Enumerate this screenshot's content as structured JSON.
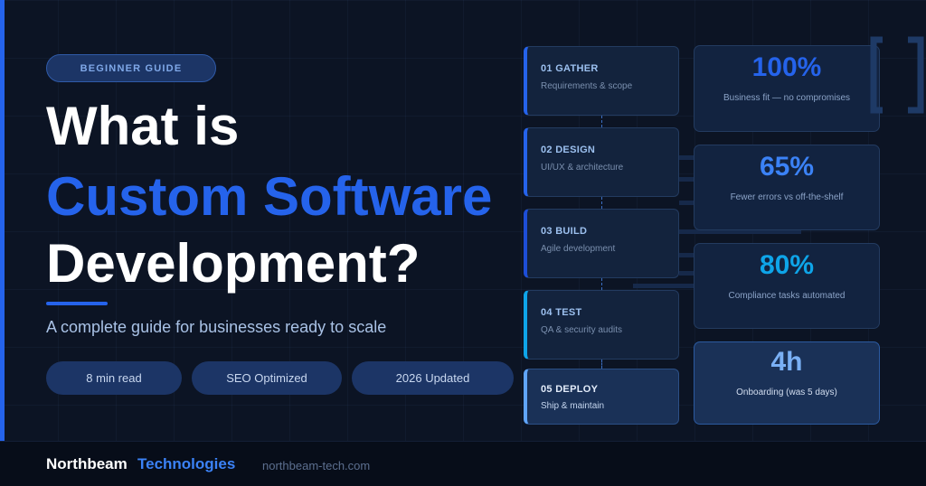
{
  "badge": "BEGINNER GUIDE",
  "title": {
    "line1": "What is",
    "line2": "Custom Software",
    "line3": "Development?"
  },
  "subtitle": "A complete guide for businesses ready to scale",
  "pills": [
    "8 min read",
    "SEO Optimized",
    "2026 Updated"
  ],
  "steps": [
    {
      "num": "01 GATHER",
      "desc": "Requirements & scope"
    },
    {
      "num": "02 DESIGN",
      "desc": "UI/UX & architecture"
    },
    {
      "num": "03 BUILD",
      "desc": "Agile development"
    },
    {
      "num": "04 TEST",
      "desc": "QA & security audits"
    },
    {
      "num": "05 DEPLOY",
      "desc": "Ship & maintain"
    }
  ],
  "stats": [
    {
      "value": "100%",
      "label": "Business fit — no compromises"
    },
    {
      "value": "65%",
      "label": "Fewer errors vs off-the-shelf"
    },
    {
      "value": "80%",
      "label": "Compliance tasks automated"
    },
    {
      "value": "4h",
      "label": "Onboarding (was 5 days)"
    }
  ],
  "footer": {
    "brand_primary": "Northbeam",
    "brand_secondary": "Technologies",
    "website": "northbeam-tech.com"
  },
  "colors": {
    "accent": "#2563eb",
    "background": "#0c1424",
    "card": "#13233d"
  }
}
